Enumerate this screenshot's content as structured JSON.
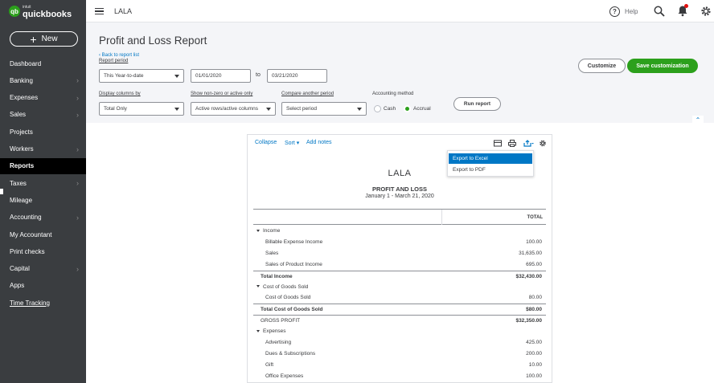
{
  "app": {
    "logo_small": "intuit",
    "logo_brand": "quickbooks",
    "new_label": "New"
  },
  "sidebar": {
    "items": [
      {
        "label": "Dashboard",
        "chevron": false
      },
      {
        "label": "Banking",
        "chevron": true
      },
      {
        "label": "Expenses",
        "chevron": true
      },
      {
        "label": "Sales",
        "chevron": true
      },
      {
        "label": "Projects",
        "chevron": false
      },
      {
        "label": "Workers",
        "chevron": true
      },
      {
        "label": "Reports",
        "chevron": false,
        "active": true
      },
      {
        "label": "Taxes",
        "chevron": true
      },
      {
        "label": "Mileage",
        "chevron": false
      },
      {
        "label": "Accounting",
        "chevron": true
      },
      {
        "label": "My Accountant",
        "chevron": false
      },
      {
        "label": "Print checks",
        "chevron": false
      },
      {
        "label": "Capital",
        "chevron": true
      },
      {
        "label": "Apps",
        "chevron": false
      },
      {
        "label": "Time Tracking",
        "chevron": false
      }
    ]
  },
  "topbar": {
    "company": "LALA",
    "help_label": "Help"
  },
  "page": {
    "title": "Profit and Loss Report",
    "back_link": "Back to report list",
    "report_period_label": "Report period",
    "period_value": "This Year-to-date",
    "date_from": "01/01/2020",
    "date_to_label": "to",
    "date_to": "03/21/2020",
    "display_columns_label": "Display columns by",
    "display_columns_value": "Total Only",
    "show_nonzero_label": "Show non-zero or active only",
    "show_nonzero_value": "Active rows/active columns",
    "compare_label": "Compare another period",
    "compare_value": "Select period",
    "acct_method_label": "Accounting method",
    "cash_label": "Cash",
    "accrual_label": "Accrual",
    "run_report_label": "Run report",
    "customize_label": "Customize",
    "save_custom_label": "Save customization",
    "collapse_caret": "⌃"
  },
  "report_toolbar": {
    "collapse": "Collapse",
    "sort": "Sort",
    "add_notes": "Add notes"
  },
  "export_menu": {
    "excel": "Export to Excel",
    "pdf": "Export to PDF"
  },
  "report": {
    "company": "LALA",
    "title": "PROFIT AND LOSS",
    "date_range": "January 1 - March 21, 2020",
    "col_total": "TOTAL",
    "rows": [
      {
        "label": "Income",
        "amount": "",
        "level": 0,
        "toggle": true
      },
      {
        "label": "Billable Expense Income",
        "amount": "100.00",
        "level": 1
      },
      {
        "label": "Sales",
        "amount": "31,635.00",
        "level": 1
      },
      {
        "label": "Sales of Product Income",
        "amount": "695.00",
        "level": 1
      },
      {
        "label": "Total Income",
        "amount": "$32,430.00",
        "level": 0,
        "bold": true,
        "line": true
      },
      {
        "label": "Cost of Goods Sold",
        "amount": "",
        "level": 0,
        "toggle": true
      },
      {
        "label": "Cost of Goods Sold",
        "amount": "80.00",
        "level": 1
      },
      {
        "label": "Total Cost of Goods Sold",
        "amount": "$80.00",
        "level": 0,
        "bold": true,
        "line": true
      },
      {
        "label": "GROSS PROFIT",
        "amount": "$32,350.00",
        "level": 0,
        "bold_amount": true,
        "line": true
      },
      {
        "label": "Expenses",
        "amount": "",
        "level": 0,
        "toggle": true
      },
      {
        "label": "Advertising",
        "amount": "425.00",
        "level": 1
      },
      {
        "label": "Dues & Subscriptions",
        "amount": "200.00",
        "level": 1
      },
      {
        "label": "Gift",
        "amount": "10.00",
        "level": 1
      },
      {
        "label": "Office Expenses",
        "amount": "100.00",
        "level": 1
      }
    ]
  }
}
